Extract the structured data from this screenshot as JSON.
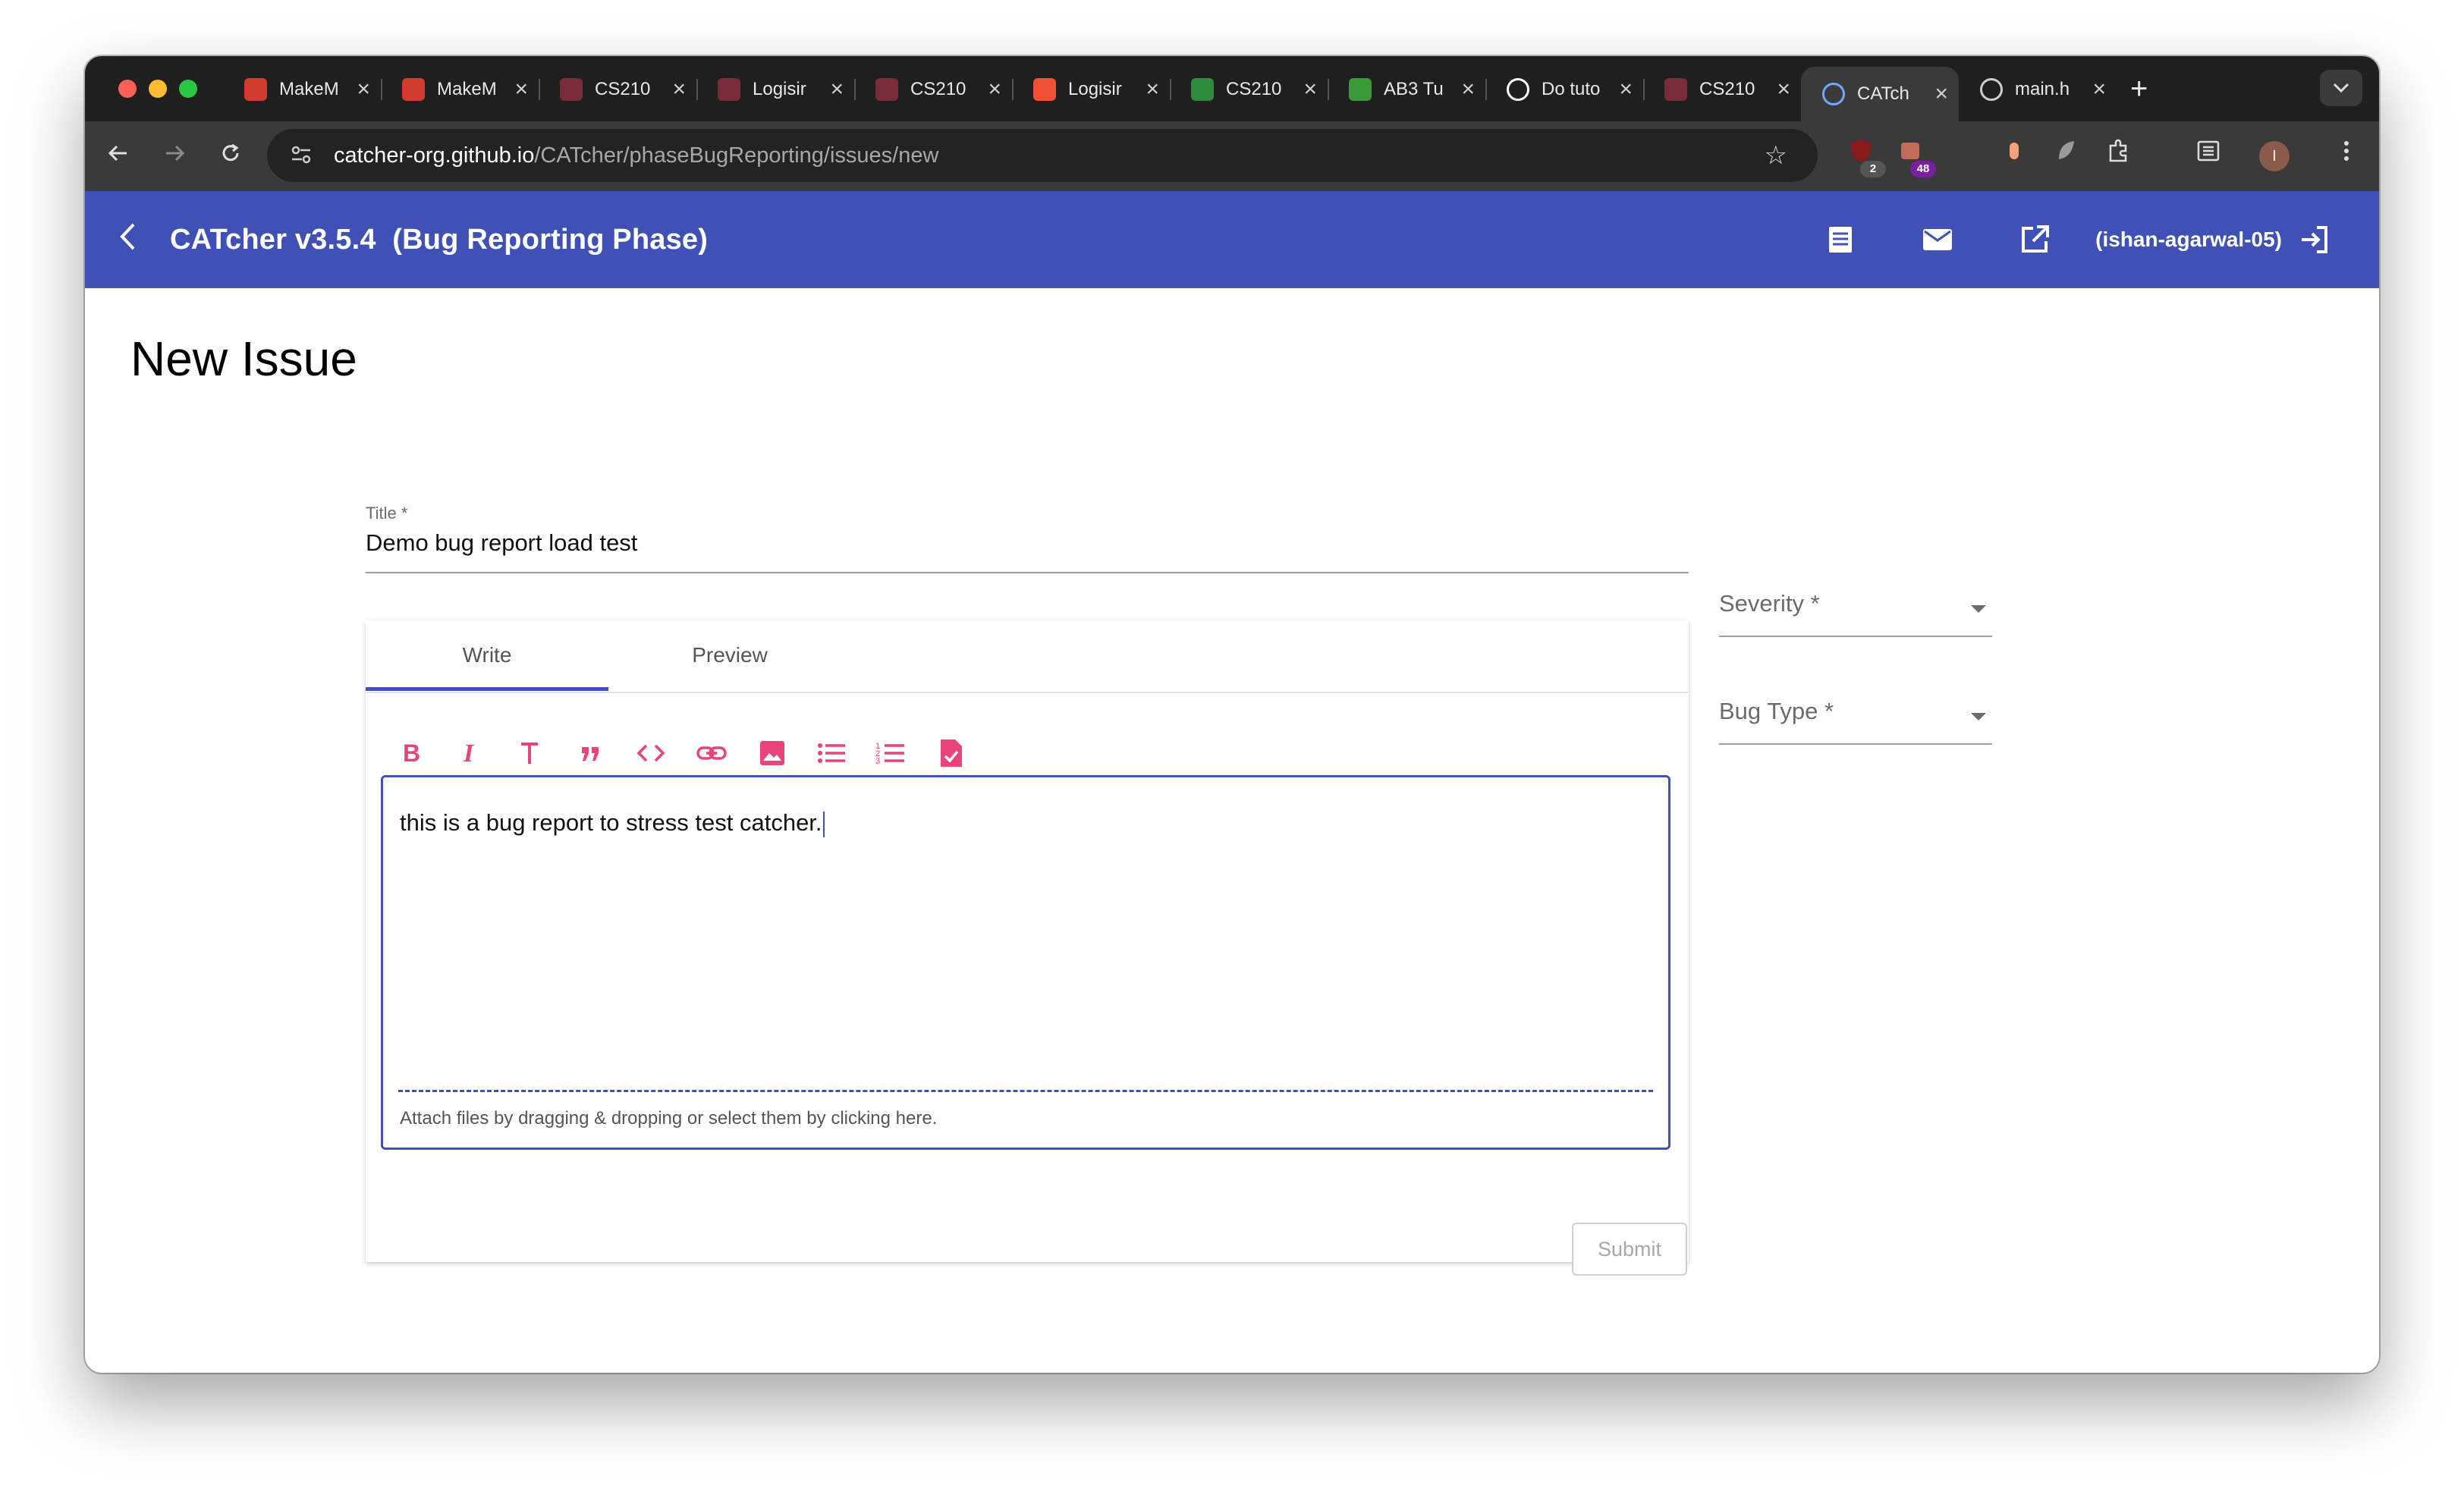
{
  "browser": {
    "tabs": [
      {
        "label": "MakeM",
        "favicon": "makemytrip-icon",
        "color": "#d23b2f",
        "active": false
      },
      {
        "label": "MakeM",
        "favicon": "makemytrip-icon",
        "color": "#d23b2f",
        "active": false
      },
      {
        "label": "CS210",
        "favicon": "nus-shield-icon",
        "color": "#7a2c3a",
        "active": false
      },
      {
        "label": "Logisir",
        "favicon": "nus-shield-icon",
        "color": "#7a2c3a",
        "active": false
      },
      {
        "label": "CS210",
        "favicon": "nus-shield-icon",
        "color": "#7a2c3a",
        "active": false
      },
      {
        "label": "Logisir",
        "favicon": "git-icon",
        "color": "#f05033",
        "active": false
      },
      {
        "label": "CS210",
        "favicon": "graduation-cap-icon",
        "color": "#2e8b3e",
        "active": false
      },
      {
        "label": "AB3 Tu",
        "favicon": "book-icon",
        "color": "#3a9a3a",
        "active": false
      },
      {
        "label": "Do tuto",
        "favicon": "github-icon",
        "color": "#ffffff",
        "active": false
      },
      {
        "label": "CS210",
        "favicon": "nus-shield-icon",
        "color": "#7a2c3a",
        "active": false
      },
      {
        "label": "CATch",
        "favicon": "catcher-icon",
        "color": "#6fa8ff",
        "active": true
      },
      {
        "label": "main.h",
        "favicon": "globe-icon",
        "color": "#cccccc",
        "active": false
      }
    ],
    "new_tab": "+",
    "url_host": "catcher-org.github.io",
    "url_path": "/CATcher/phaseBugReporting/issues/new",
    "extensions": {
      "ublock_badge": "2",
      "second_badge": "48",
      "profile_initial": "I"
    }
  },
  "appbar": {
    "title": "CATcher v3.5.4  (Bug Reporting Phase)",
    "user": "(ishan-agarwal-05)",
    "color": "#3f51b5"
  },
  "page": {
    "title": "New Issue"
  },
  "form": {
    "title_label": "Title *",
    "title_value": "Demo bug report load test",
    "severity_label": "Severity *",
    "bug_type_label": "Bug Type *",
    "tabs": [
      "Write",
      "Preview"
    ],
    "toolbar_icons": [
      "bold-icon",
      "italic-icon",
      "heading-icon",
      "quote-icon",
      "code-icon",
      "link-icon",
      "image-icon",
      "bulleted-list-icon",
      "numbered-list-icon",
      "task-file-icon"
    ],
    "description": "this is a bug report to stress test catcher.",
    "attach_hint": "Attach files by dragging & dropping or select them by clicking here.",
    "submit_label": "Submit",
    "accent": "#e8437a"
  }
}
